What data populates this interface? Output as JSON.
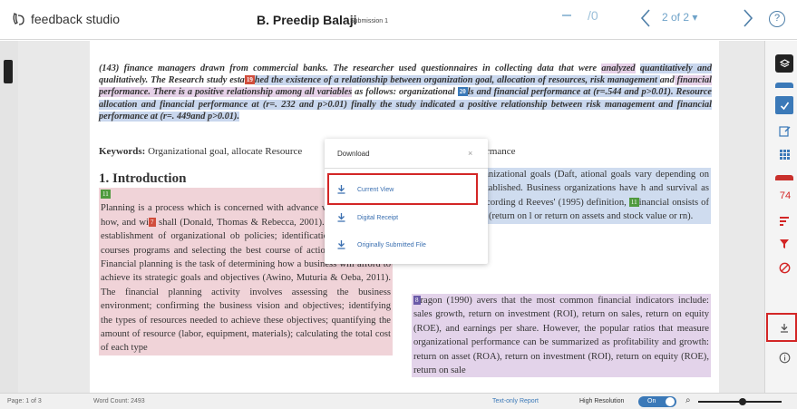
{
  "app": {
    "logo_text": "feedback studio",
    "student_name": "B. Preedip Balaji",
    "submission_label": "Submission 1",
    "score_denominator": "/0",
    "page_indicator": "2 of 2 ▾",
    "help_label": "?"
  },
  "document": {
    "abstract_segments": [
      {
        "text": "(143) finance managers drawn from commercial banks. The researcher used questionnaires in collecting data that were ",
        "hl": ""
      },
      {
        "text": "analyzed",
        "hl": "p"
      },
      {
        "text": " ",
        "hl": ""
      },
      {
        "text": "quantitatively and",
        "hl": "b"
      },
      {
        "text": " qualitatively. The Research study esta",
        "hl": ""
      },
      {
        "mark": "19",
        "color": "#d14d3c"
      },
      {
        "text": "hed the existence of a relationship between organization goal, allocation of resources, risk management ",
        "hl": "b"
      },
      {
        "text": "and",
        "hl": ""
      },
      {
        "text": " financial performance. There is a positive relationship among all ",
        "hl": "p"
      },
      {
        "text": "variables",
        "hl": "p"
      },
      {
        "text": " as follows: organizational ",
        "hl": ""
      },
      {
        "mark": "20",
        "color": "#3b79b8"
      },
      {
        "text": "ls and financial performance at (r=.544 and p>0.01). Resource allocation and financial performance at (r=. 232 and p>0.01) finally the study indicated a positive relationship between risk management and financial performance at (r=. 449and p>0.01).",
        "hl": "b"
      }
    ],
    "keywords_label": "Keywords:",
    "keywords_left": "Organizational goal, allocate Resource",
    "keywords_right": "formance",
    "intro_heading": "1. Introduction",
    "left_mark": "11",
    "left_paragraph_pre": "Planning is a process which is concerned with advance what, when, why, how, and wi",
    "left_mark_inline": "7",
    "left_paragraph_post": " shall (Donald, Thomas & Rebecca, 2001). Genera involves establishment of organizational ob policies; identification of alternative courses programs and selecting the best course of action and programs. Financial planning is the task of determining how a business will afford to achieve its strategic goals and objectives (Awino, Muturia & Oeba, 2011). The financial planning activity involves assessing the business environment; confirming the business vision and objectives; identifying the types of resources needed to achieve these objectives; quantifying the amount of resource (labor, equipment, materials); calculating the total cost of each type",
    "right_paragraph1_pre": "ler to achieve organizational goals (Daft, ational goals vary depending on the purpose are established. Business organizations have h and survival as the main goals. According d Reeves' (1995) definition, ",
    "right_mark": "11",
    "right_paragraph1_post": "inancial onsists of financial outcomes (return on l or return on assets and stock value or rn).",
    "right_mark2": "8",
    "right_paragraph2": "ragon (1990) avers that the most common financial indicators include: sales growth, return on investment (ROI), return on sales, return on equity (ROE), and earnings per share. However, the popular ratios that measure organizational performance can be summarized as profitability and growth: return on asset (ROA), return on investment (ROI), return on equity (ROE), return on sale"
  },
  "download_modal": {
    "title": "Download",
    "close_label": "×",
    "options": [
      {
        "label": "Current View"
      },
      {
        "label": "Digital Receipt"
      },
      {
        "label": "Originally Submitted File"
      }
    ]
  },
  "toolbar": {
    "similarity_count": "74"
  },
  "statusbar": {
    "page_label": "Page: 1 of 3",
    "word_count": "Word Count: 2493",
    "text_only": "Text-only Report",
    "high_res": "High Resolution",
    "toggle_state": "On",
    "zoom_icon_label": "⌕"
  },
  "colors": {
    "accent": "#3b79b8",
    "alert": "#d32626"
  }
}
